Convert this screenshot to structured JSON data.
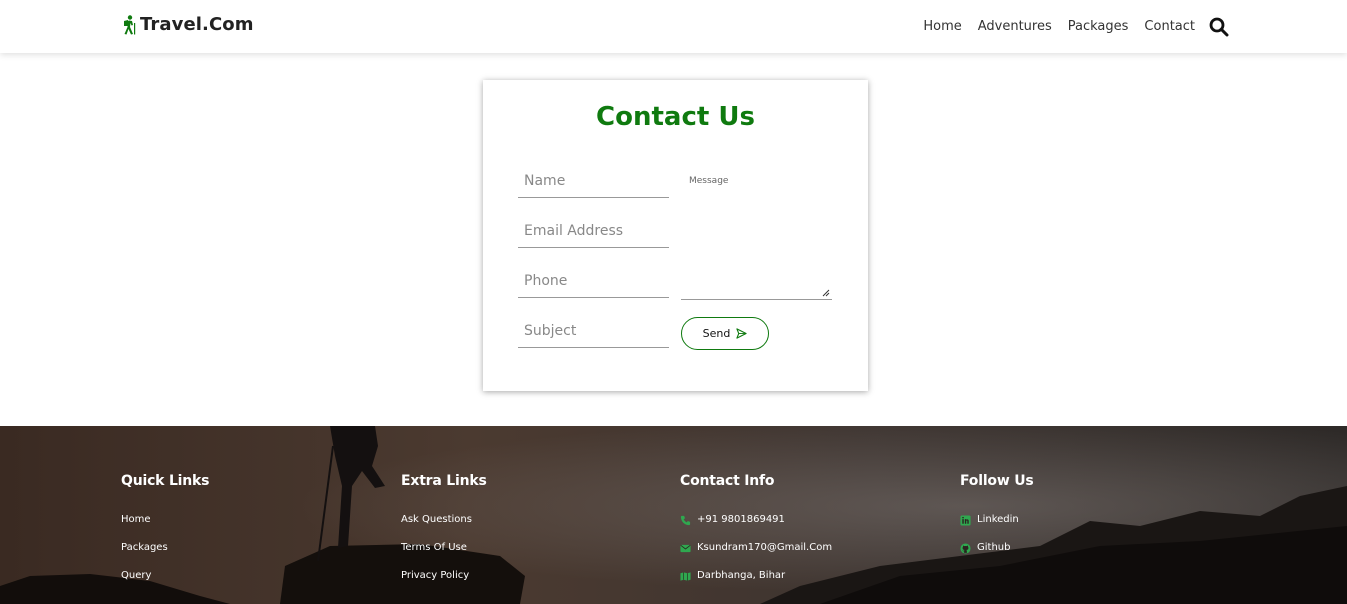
{
  "header": {
    "logo_text": "Travel.Com",
    "nav": [
      {
        "label": "Home"
      },
      {
        "label": "Adventures"
      },
      {
        "label": "Packages"
      },
      {
        "label": "Contact"
      }
    ]
  },
  "contact": {
    "title": "Contact Us",
    "name_placeholder": "Name",
    "email_placeholder": "Email Address",
    "phone_placeholder": "Phone",
    "subject_placeholder": "Subject",
    "message_placeholder": "Message",
    "send_label": "Send"
  },
  "footer": {
    "quick_links": {
      "title": "Quick Links",
      "items": [
        "Home",
        "Packages",
        "Query"
      ]
    },
    "extra_links": {
      "title": "Extra Links",
      "items": [
        "Ask Questions",
        "Terms Of Use",
        "Privacy Policy"
      ]
    },
    "contact_info": {
      "title": "Contact Info",
      "phone": "+91 9801869491",
      "email": "Ksundram170@Gmail.Com",
      "address": "Darbhanga, Bihar"
    },
    "follow_us": {
      "title": "Follow Us",
      "linkedin": "Linkedin",
      "github": "Github"
    }
  },
  "colors": {
    "accent": "#0f7a0f",
    "icon_green": "#2fa84f"
  }
}
